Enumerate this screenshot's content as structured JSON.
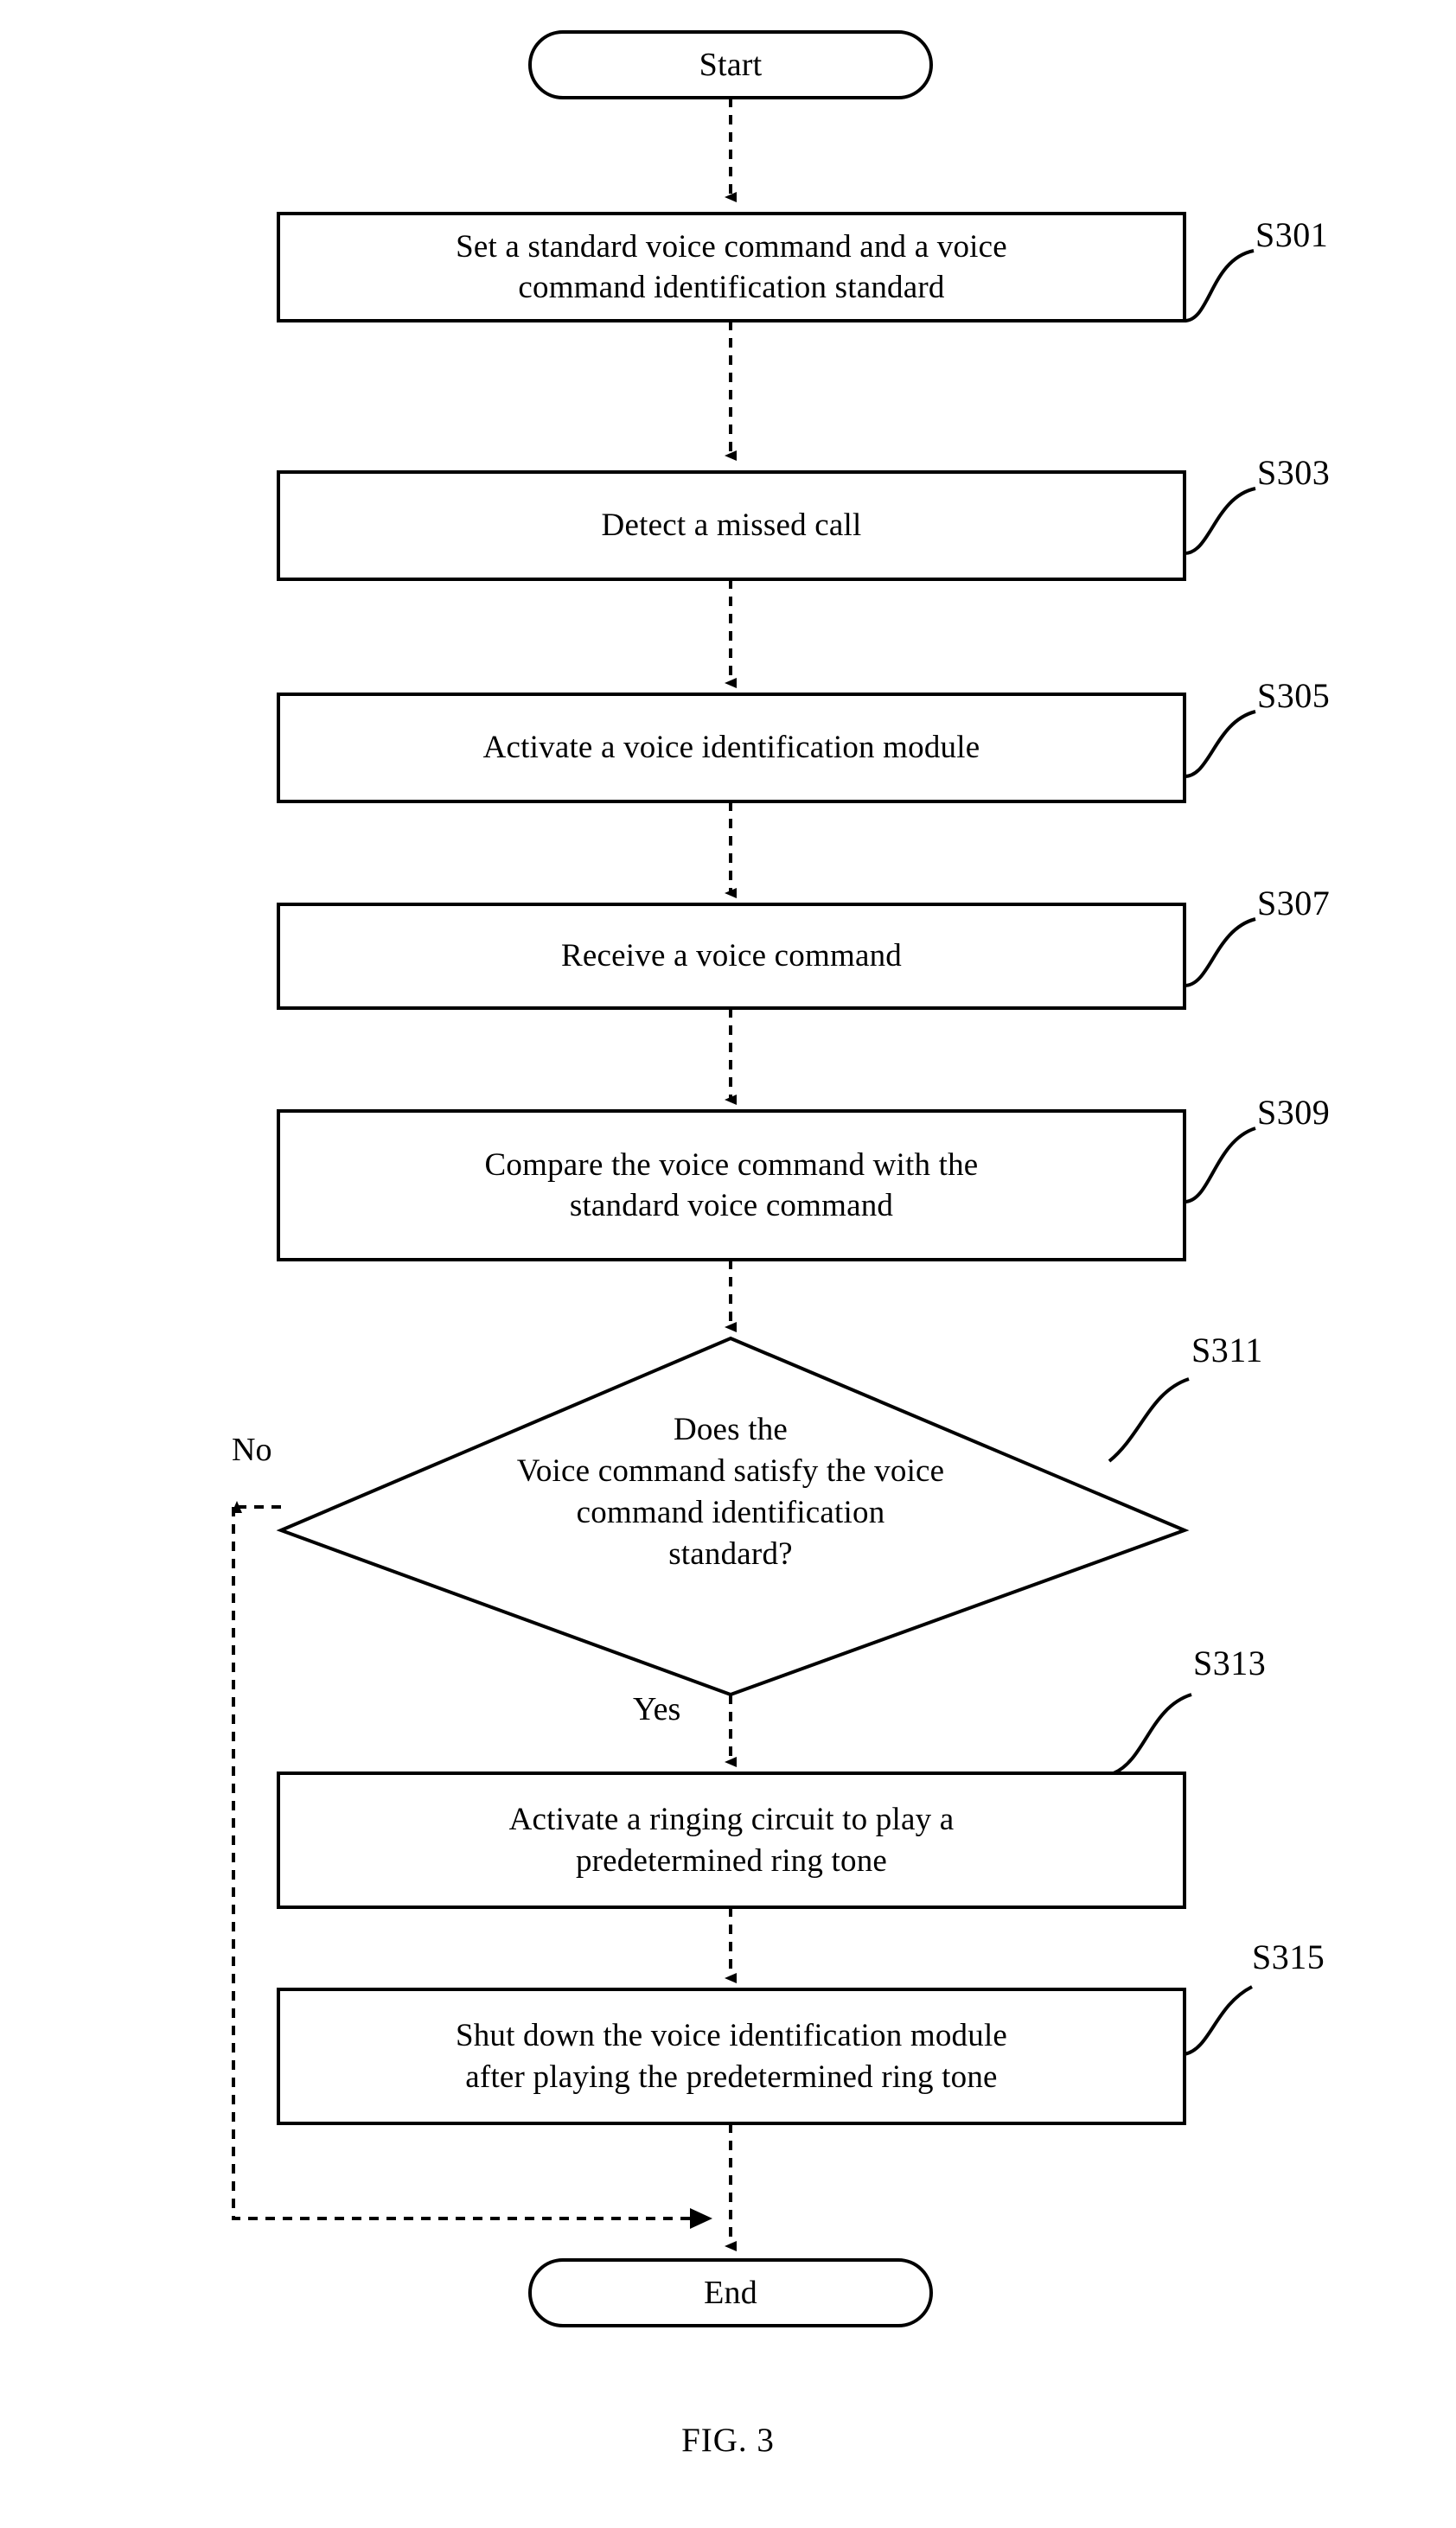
{
  "figure": {
    "caption": "FIG. 3",
    "type": "flowchart"
  },
  "nodes": {
    "start": {
      "label": "Start",
      "shape": "terminator"
    },
    "end": {
      "label": "End",
      "shape": "terminator"
    },
    "s301": {
      "label": "Set a standard voice command and a voice\ncommand identification standard",
      "step": "S301",
      "shape": "process"
    },
    "s303": {
      "label": "Detect a missed call",
      "step": "S303",
      "shape": "process"
    },
    "s305": {
      "label": "Activate a voice identification module",
      "step": "S305",
      "shape": "process"
    },
    "s307": {
      "label": "Receive a voice command",
      "step": "S307",
      "shape": "process"
    },
    "s309": {
      "label": "Compare the voice command with the\nstandard voice command",
      "step": "S309",
      "shape": "process"
    },
    "s311": {
      "label": "Does the\nVoice command satisfy the voice\ncommand identification\nstandard?",
      "step": "S311",
      "shape": "decision"
    },
    "s313": {
      "label": "Activate a ringing circuit to play a\npredetermined ring tone",
      "step": "S313",
      "shape": "process"
    },
    "s315": {
      "label": "Shut down the voice identification module\nafter playing the predetermined ring tone",
      "step": "S315",
      "shape": "process"
    }
  },
  "branches": {
    "no": "No",
    "yes": "Yes"
  },
  "colors": {
    "stroke": "#000000",
    "fill": "#ffffff",
    "text": "#000000"
  }
}
